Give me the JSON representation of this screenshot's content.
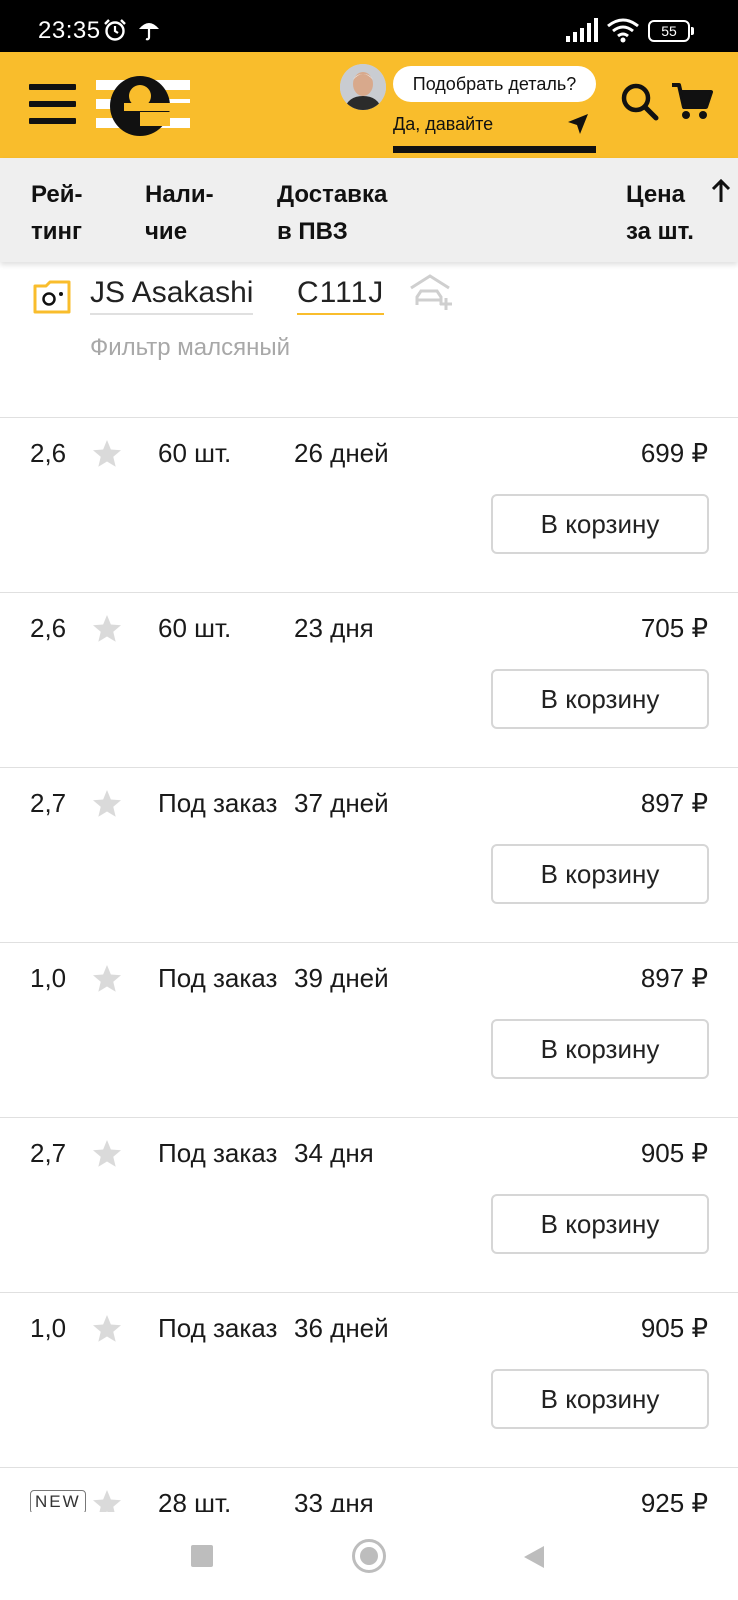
{
  "status": {
    "time": "23:35",
    "battery": "55"
  },
  "header": {
    "prompt": "Подобрать деталь?",
    "prompt_action": "Да, давайте"
  },
  "columns": {
    "rating_line1": "Рей-",
    "rating_line2": "тинг",
    "availability_line1": "Нали-",
    "availability_line2": "чие",
    "delivery_line1": "Доставка",
    "delivery_line2": "в ПВЗ",
    "price_line1": "Цена",
    "price_line2": "за шт."
  },
  "product": {
    "brand": "JS Asakashi",
    "article": "C111J",
    "description": "Фильтр малсяный"
  },
  "offers": [
    {
      "rating": "2,6",
      "availability": "60 шт.",
      "delivery": "26 дней",
      "price": "699 ₽",
      "button": "В корзину"
    },
    {
      "rating": "2,6",
      "availability": "60 шт.",
      "delivery": "23 дня",
      "price": "705 ₽",
      "button": "В корзину"
    },
    {
      "rating": "2,7",
      "availability": "Под заказ",
      "delivery": "37 дней",
      "price": "897 ₽",
      "button": "В корзину"
    },
    {
      "rating": "1,0",
      "availability": "Под заказ",
      "delivery": "39 дней",
      "price": "897 ₽",
      "button": "В корзину"
    },
    {
      "rating": "2,7",
      "availability": "Под заказ",
      "delivery": "34 дня",
      "price": "905 ₽",
      "button": "В корзину"
    },
    {
      "rating": "1,0",
      "availability": "Под заказ",
      "delivery": "36 дней",
      "price": "905 ₽",
      "button": "В корзину"
    },
    {
      "badge": "NEW",
      "availability": "28 шт.",
      "delivery": "33 дня",
      "price": "925 ₽"
    }
  ],
  "icons": {
    "menu": "hamburger-icon",
    "search": "search-icon",
    "cart": "cart-icon",
    "photo": "photo-folder-icon",
    "garage": "add-to-garage-icon",
    "star": "star-icon",
    "sort": "arrow-up-icon"
  },
  "colors": {
    "brand_yellow": "#f9bd2c",
    "text": "#1a1a1a",
    "muted": "#a8a8a8"
  }
}
